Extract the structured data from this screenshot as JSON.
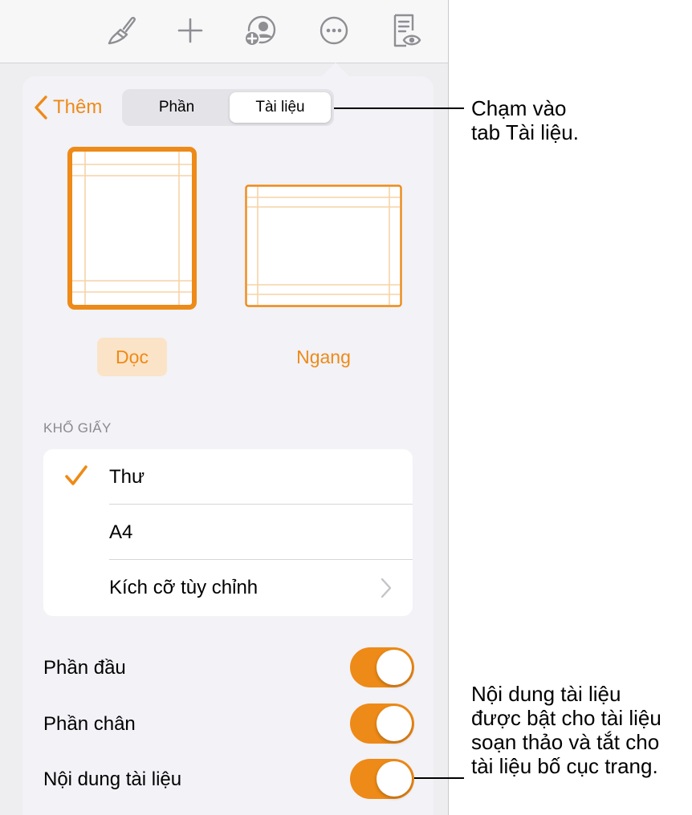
{
  "toolbar": {
    "icons": [
      "paintbrush-icon",
      "plus-icon",
      "collaborate-icon",
      "more-icon",
      "reader-view-icon"
    ]
  },
  "header": {
    "back_label": "Thêm",
    "tabs": [
      {
        "label": "Phần",
        "selected": false
      },
      {
        "label": "Tài liệu",
        "selected": true
      }
    ]
  },
  "orientation": {
    "portrait_label": "Dọc",
    "landscape_label": "Ngang",
    "selected": "portrait"
  },
  "paper_size": {
    "header": "KHỔ GIẤY",
    "items": [
      {
        "label": "Thư",
        "checked": true
      },
      {
        "label": "A4",
        "checked": false
      },
      {
        "label": "Kích cỡ tùy chỉnh",
        "checked": false,
        "has_chevron": true
      }
    ]
  },
  "toggles": [
    {
      "label": "Phần đầu",
      "on": true
    },
    {
      "label": "Phần chân",
      "on": true
    },
    {
      "label": "Nội dung tài liệu",
      "on": true
    }
  ],
  "callouts": {
    "top_lines": [
      "Chạm vào",
      "tab Tài liệu."
    ],
    "bottom_lines": [
      "Nội dung tài liệu",
      "được bật cho tài liệu",
      "soạn thảo và tắt cho",
      "tài liệu bố cục trang."
    ]
  },
  "colors": {
    "accent": "#ee8a17",
    "accent_light": "#fbe3c7",
    "guide_line": "#f6d3a6",
    "background": "#eeeef1",
    "popover": "#f2f2f7"
  }
}
